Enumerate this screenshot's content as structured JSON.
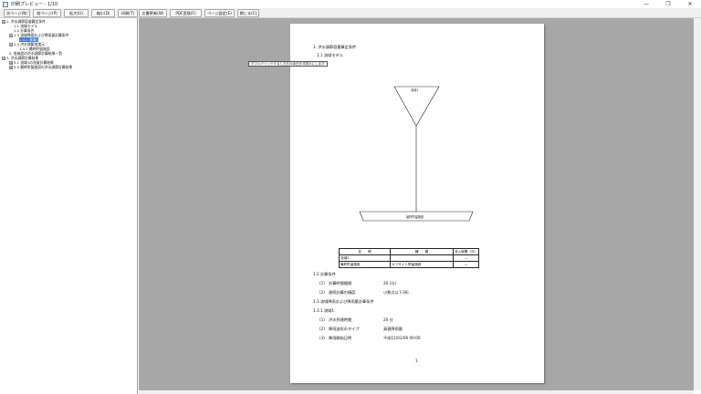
{
  "window": {
    "title": "印刷プレビュー - 1/10",
    "controls": [
      "—",
      "❐",
      "✕"
    ]
  },
  "toolbar": {
    "buttons": [
      "次ページ(N)",
      "前ページ(P)",
      "拡大(U)",
      "縮小(D)",
      "印刷(T)",
      "文書更新(W)",
      "PDF変換(F)",
      "ページ設定(E)",
      "閉じる(C)"
    ]
  },
  "tree": {
    "items": [
      {
        "expander": "⊟",
        "label": "1. 洪水調節容量算定条件"
      },
      {
        "expander": "",
        "label": "1.1 流域モデル"
      },
      {
        "expander": "",
        "label": "1.2 計算条件"
      },
      {
        "expander": "⊟",
        "label": "1.3 流域降雨および降雨量計算条件"
      },
      {
        "expander": "",
        "label": "1.3.1 流域1"
      },
      {
        "expander": "⊟",
        "label": "1.4 洪水調節池諸元"
      },
      {
        "expander": "",
        "label": "1.4.1 最終貯留施設"
      },
      {
        "expander": "",
        "label": "2. 各施設の洪水調節計算結果一覧"
      },
      {
        "expander": "⊟",
        "label": "3. 洪水調節計算結果"
      },
      {
        "expander": "⊞",
        "label": "3.1 流域1の流量計算結果"
      },
      {
        "expander": "⊞",
        "label": "3.2 最終貯留施設の洪水調節計算結果"
      }
    ]
  },
  "page": {
    "heading": "1. 洪水調節容量算定条件",
    "sub_heading": "1.1 流域モデル",
    "tooltip": "ダブルクリックすると左右の余白を非表示にします",
    "diagram": {
      "basin_label": "流域1",
      "facility_label": "最終貯留施設"
    },
    "table": {
      "headers": [
        "名　　称",
        "種　　類",
        "流入時間（分）"
      ],
      "rows": [
        [
          "流域1",
          "",
          "—"
        ],
        [
          "最終貯留施設",
          "オフサイト貯留施設",
          "—"
        ]
      ]
    },
    "section_1_2": "1.2 計算条件",
    "calc_conditions": [
      {
        "num": "(1)",
        "label": "計算時間間隔",
        "value": "20 (分)"
      },
      {
        "num": "(2)",
        "label": "連続計算の精度",
        "value": "小数点以下3桁"
      }
    ],
    "section_1_3": "1.3 流域降雨および降雨量計算条件",
    "section_1_3_1": "1.3.1 流域1",
    "rain_conditions": [
      {
        "num": "(1)",
        "label": "洪水到達時間",
        "value": "20 分"
      },
      {
        "num": "(2)",
        "label": "降雨波形のタイプ",
        "value": "真値降雨量"
      },
      {
        "num": "(3)",
        "label": "降雨開始日時",
        "value": "平成15/01/06 00:00"
      }
    ],
    "page_number": "1"
  }
}
